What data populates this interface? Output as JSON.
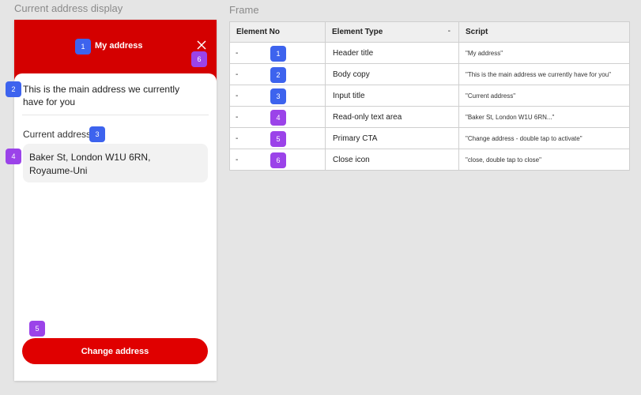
{
  "canvas": {
    "left_label": "Current address display",
    "right_label": "Frame"
  },
  "screen": {
    "header_title": "My address",
    "close_icon": "close-icon",
    "body_copy": "This is the main address we currently have for you",
    "input_title": "Current address",
    "address": "Baker St, London W1U 6RN, Royaume-Uni",
    "cta_label": "Change address",
    "colors": {
      "header_bg": "#d40000",
      "cta_bg": "#e00000",
      "sheet_bg": "#ffffff"
    }
  },
  "annotations": {
    "header_title": "1",
    "body_copy": "2",
    "input_title": "3",
    "readonly_area": "4",
    "cta": "5",
    "close_icon": "6",
    "colors": {
      "blue": "#3d63ee",
      "purple": "#9b43e9"
    }
  },
  "table": {
    "headers": {
      "no": "Element No",
      "type": "Element Type",
      "type_extra": "-",
      "script": "Script"
    },
    "rows": [
      {
        "dash": "-",
        "badge": "1",
        "badge_color": "blue",
        "type": "Header title",
        "script": "\"My address\""
      },
      {
        "dash": "-",
        "badge": "2",
        "badge_color": "blue",
        "type": "Body copy",
        "script": "\"This is the main address we currently have for you\""
      },
      {
        "dash": "-",
        "badge": "3",
        "badge_color": "blue",
        "type": " Input title",
        "script": "\"Current address\""
      },
      {
        "dash": "-",
        "badge": "4",
        "badge_color": "purple",
        "type": "Read-only text area",
        "script": "\"Baker St, London W1U 6RN...\""
      },
      {
        "dash": "-",
        "badge": "5",
        "badge_color": "purple",
        "type": "Primary CTA",
        "script": "\"Change address - double tap to activate\""
      },
      {
        "dash": "-",
        "badge": "6",
        "badge_color": "purple",
        "type": "Close icon",
        "script": "\"close, double tap to close\""
      }
    ]
  }
}
